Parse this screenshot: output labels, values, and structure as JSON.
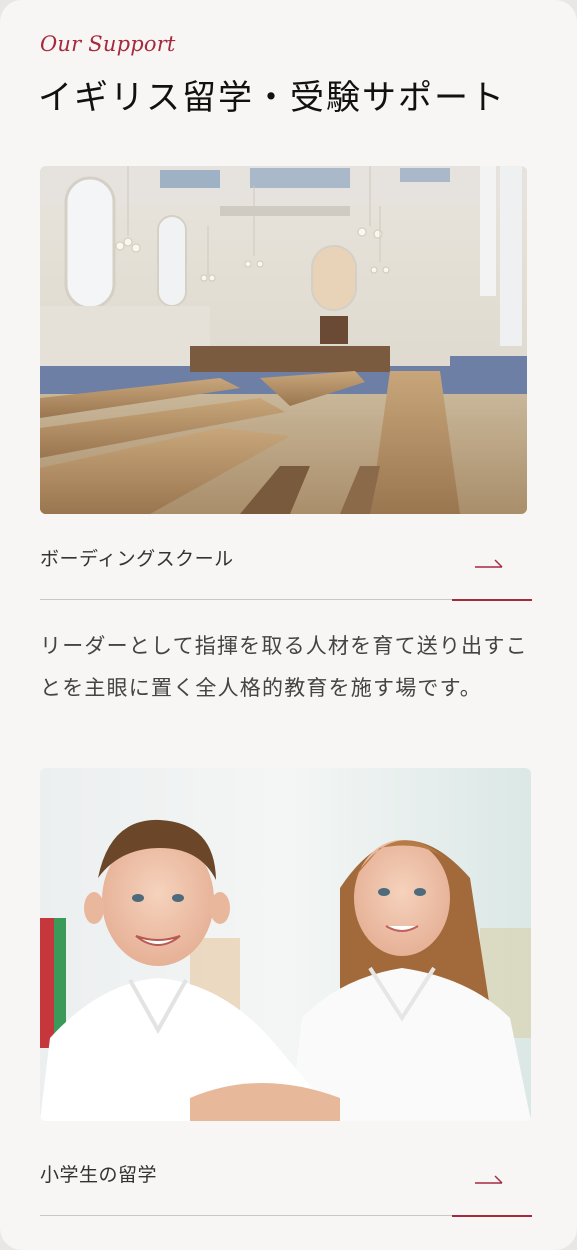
{
  "section": {
    "eyebrow": "Our Support",
    "title": "イギリス留学・受験サポート"
  },
  "items": [
    {
      "label": "ボーディングスクール",
      "description": "リーダーとして指揮を取る人材を育て送り出すことを主眼に置く全人格的教育を施す場です。",
      "image": "boarding-school-dining-hall"
    },
    {
      "label": "小学生の留学",
      "image": "primary-school-children"
    }
  ],
  "colors": {
    "accent": "#a42a3c",
    "background": "#f8f6f4",
    "text": "#333333"
  },
  "icons": {
    "link_arrow": "arrow-right-icon"
  }
}
